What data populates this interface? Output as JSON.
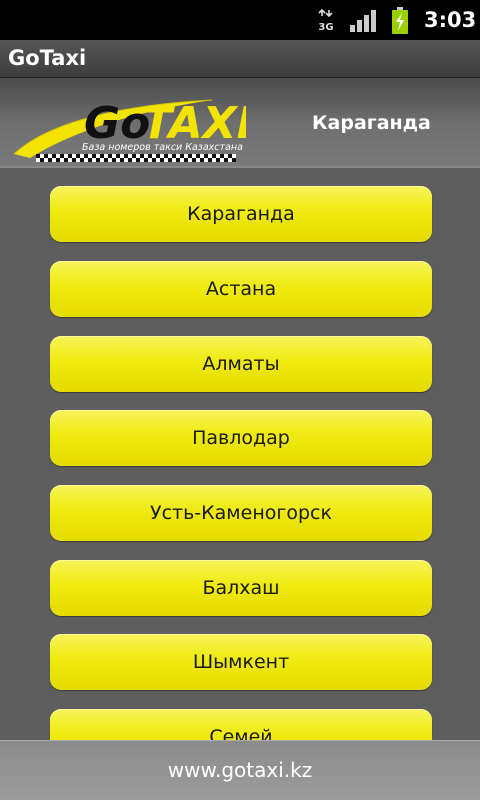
{
  "status_bar": {
    "network_label": "3G",
    "time": "3:03",
    "icons": [
      "3g-icon",
      "signal-icon",
      "battery-charging-icon"
    ]
  },
  "app": {
    "title": "GoTaxi"
  },
  "header": {
    "logo_text_go": "Go",
    "logo_text_taxi": "TAXI",
    "logo_tagline": "База номеров такси Казахстана",
    "selected_city": "Караганда"
  },
  "cities": [
    "Караганда",
    "Астана",
    "Алматы",
    "Павлодар",
    "Усть-Каменогорск",
    "Балхаш",
    "Шымкент",
    "Семей"
  ],
  "footer": {
    "website": "www.gotaxi.kz"
  },
  "colors": {
    "button_yellow": "#efea10",
    "list_background": "#5e5e5e",
    "logo_yellow": "#f2e300"
  }
}
